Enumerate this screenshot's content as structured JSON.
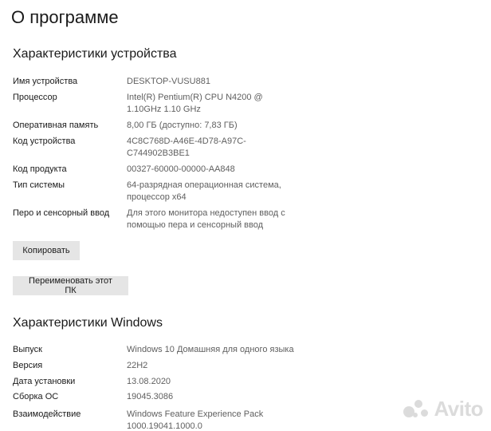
{
  "page": {
    "title": "О программе"
  },
  "device_specs": {
    "heading": "Характеристики устройства",
    "rows": [
      {
        "label": "Имя устройства",
        "value": "DESKTOP-VUSU881"
      },
      {
        "label": "Процессор",
        "value": "Intel(R) Pentium(R) CPU N4200 @ 1.10GHz 1.10 GHz"
      },
      {
        "label": "Оперативная память",
        "value": "8,00 ГБ (доступно: 7,83 ГБ)"
      },
      {
        "label": "Код устройства",
        "value": "4C8C768D-A46E-4D78-A97C-C744902B3BE1"
      },
      {
        "label": "Код продукта",
        "value": "00327-60000-00000-AA848"
      },
      {
        "label": "Тип системы",
        "value": "64-разрядная операционная система, процессор x64"
      },
      {
        "label": "Перо и сенсорный ввод",
        "value": "Для этого монитора недоступен ввод с помощью пера и сенсорный ввод"
      }
    ],
    "copy_label": "Копировать",
    "rename_label": "Переименовать этот ПК"
  },
  "windows_specs": {
    "heading": "Характеристики Windows",
    "rows": [
      {
        "label": "Выпуск",
        "value": "Windows 10 Домашняя для одного языка"
      },
      {
        "label": "Версия",
        "value": "22H2"
      },
      {
        "label": "Дата установки",
        "value": "13.08.2020"
      },
      {
        "label": "Сборка ОС",
        "value": "19045.3086"
      },
      {
        "label": "Взаимодействие",
        "value": "Windows Feature Experience Pack 1000.19041.1000.0"
      }
    ]
  },
  "watermark": {
    "text": "Avito"
  }
}
